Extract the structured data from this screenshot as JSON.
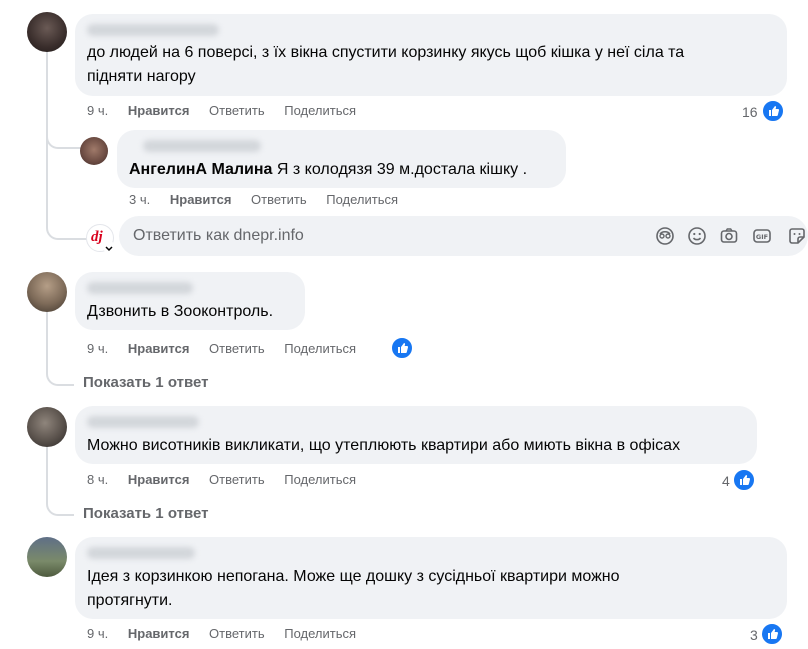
{
  "comments": [
    {
      "text_lines": [
        "до людей на 6 поверсі, з їх вікна спустити корзинку якусь щоб кішка у неї сіла та",
        "підняти нагору"
      ],
      "actions": {
        "time": "9 ч.",
        "like": "Нравится",
        "reply": "Ответить",
        "share": "Поделиться"
      },
      "reactions": "16"
    },
    {
      "mention": "АнгелинА Малина",
      "text": "Я з колодязя 39 м.достала кішку .",
      "actions": {
        "time": "3 ч.",
        "like": "Нравится",
        "reply": "Ответить",
        "share": "Поделиться"
      }
    },
    {
      "text": "Дзвонить в Зооконтроль.",
      "actions": {
        "time": "9 ч.",
        "like": "Нравится",
        "reply": "Ответить",
        "share": "Поделиться"
      },
      "show_replies": "Показать 1 ответ"
    },
    {
      "text": "Можно висотників викликати, що утеплюють квартири або миють вікна в офісах",
      "actions": {
        "time": "8 ч.",
        "like": "Нравится",
        "reply": "Ответить",
        "share": "Поделиться"
      },
      "reactions": "4",
      "show_replies": "Показать 1 ответ"
    },
    {
      "text_lines": [
        "Ідея з корзинкою непогана. Може ще дошку з сусідньої квартири можно",
        "протягнути."
      ],
      "actions": {
        "time": "9 ч.",
        "like": "Нравится",
        "reply": "Ответить",
        "share": "Поделиться"
      },
      "reactions": "3"
    }
  ],
  "reply_box": {
    "placeholder": "Ответить как dnepr.info",
    "page_logo_letters": "dj",
    "icons": [
      "avatar-sticker-icon",
      "emoji-icon",
      "camera-icon",
      "gif-icon",
      "sticker-icon"
    ]
  },
  "colors": {
    "like_blue": "#1877f2",
    "bubble_bg": "#f0f2f5",
    "secondary_text": "#65676b",
    "brand_red": "#d9001b"
  }
}
